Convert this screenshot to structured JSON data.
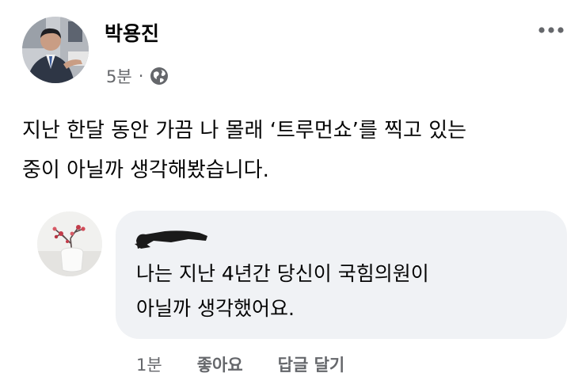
{
  "post": {
    "author": "박용진",
    "time": "5분",
    "separator": "·",
    "privacy_icon": "globe-icon",
    "more_icon": "more-options-icon",
    "text_lines": [
      "지난 한달 동안 가끔 나 몰래 ‘트루먼쇼’를 찍고 있는",
      "중이 아닐까 생각해봤습니다."
    ]
  },
  "comment": {
    "author_redacted": true,
    "text_lines": [
      "나는 지난 4년간 당신이 국힘의원이",
      "아닐까 생각했어요."
    ],
    "time": "1분",
    "like_label": "좋아요",
    "reply_label": "답글 달기"
  },
  "colors": {
    "text_primary": "#050505",
    "text_secondary": "#65676b",
    "bubble_bg": "#f0f2f5",
    "background": "#ffffff"
  }
}
